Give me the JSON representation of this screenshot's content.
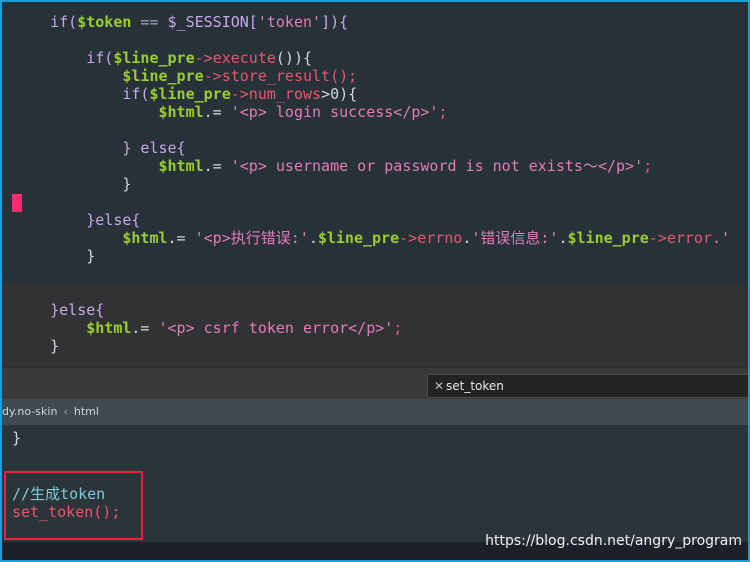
{
  "editor": {
    "lines": [
      [
        {
          "t": "    ",
          "c": "pl"
        },
        {
          "t": "if(",
          "c": "kw"
        },
        {
          "t": "$token",
          "c": "var"
        },
        {
          "t": " == ",
          "c": "op"
        },
        {
          "t": "$_SESSION[",
          "c": "kw"
        },
        {
          "t": "'token'",
          "c": "str"
        },
        {
          "t": "]){",
          "c": "kw"
        }
      ],
      [],
      [
        {
          "t": "        ",
          "c": "pl"
        },
        {
          "t": "if(",
          "c": "kw"
        },
        {
          "t": "$line_pre",
          "c": "var"
        },
        {
          "t": "->",
          "c": "fn"
        },
        {
          "t": "execute",
          "c": "fn"
        },
        {
          "t": "()){",
          "c": "pl"
        }
      ],
      [
        {
          "t": "            ",
          "c": "pl"
        },
        {
          "t": "$line_pre",
          "c": "var"
        },
        {
          "t": "->",
          "c": "fn"
        },
        {
          "t": "store_result",
          "c": "fn"
        },
        {
          "t": "();",
          "c": "fn"
        }
      ],
      [
        {
          "t": "            ",
          "c": "pl"
        },
        {
          "t": "if(",
          "c": "kw"
        },
        {
          "t": "$line_pre",
          "c": "var"
        },
        {
          "t": "->",
          "c": "fn"
        },
        {
          "t": "num_rows",
          "c": "fn"
        },
        {
          "t": ">0){",
          "c": "pl"
        }
      ],
      [
        {
          "t": "                ",
          "c": "pl"
        },
        {
          "t": "$html",
          "c": "var"
        },
        {
          "t": ".= ",
          "c": "pl"
        },
        {
          "t": "'<p> login success</p>'",
          "c": "str"
        },
        {
          "t": ";",
          "c": "fn"
        }
      ],
      [],
      [
        {
          "t": "            ",
          "c": "pl"
        },
        {
          "t": "} else{",
          "c": "kw"
        }
      ],
      [
        {
          "t": "                ",
          "c": "pl"
        },
        {
          "t": "$html",
          "c": "var"
        },
        {
          "t": ".= ",
          "c": "pl"
        },
        {
          "t": "'<p> username or password is not exists～</p>'",
          "c": "str"
        },
        {
          "t": ";",
          "c": "fn"
        }
      ],
      [
        {
          "t": "            ",
          "c": "pl"
        },
        {
          "t": "}",
          "c": "pl"
        }
      ],
      [],
      [
        {
          "t": "        ",
          "c": "pl"
        },
        {
          "t": "}else{",
          "c": "kw"
        }
      ],
      [
        {
          "t": "            ",
          "c": "pl"
        },
        {
          "t": "$html",
          "c": "var"
        },
        {
          "t": ".= ",
          "c": "pl"
        },
        {
          "t": "'<p>执行错误:'",
          "c": "str"
        },
        {
          "t": ".",
          "c": "pl"
        },
        {
          "t": "$line_pre",
          "c": "var"
        },
        {
          "t": "->",
          "c": "fn"
        },
        {
          "t": "errno",
          "c": "fn"
        },
        {
          "t": ".",
          "c": "pl"
        },
        {
          "t": "'错误信息:'",
          "c": "str"
        },
        {
          "t": ".",
          "c": "pl"
        },
        {
          "t": "$line_pre",
          "c": "var"
        },
        {
          "t": "->",
          "c": "fn"
        },
        {
          "t": "error",
          "c": "fn"
        },
        {
          "t": ".'",
          "c": "str"
        }
      ],
      [
        {
          "t": "        ",
          "c": "pl"
        },
        {
          "t": "}",
          "c": "pl"
        }
      ],
      [],
      [],
      [
        {
          "t": "    ",
          "c": "pl"
        },
        {
          "t": "}else{",
          "c": "kw"
        }
      ],
      [
        {
          "t": "        ",
          "c": "pl"
        },
        {
          "t": "$html",
          "c": "var"
        },
        {
          "t": ".= ",
          "c": "pl"
        },
        {
          "t": "'<p> csrf token error</p>'",
          "c": "str"
        },
        {
          "t": ";",
          "c": "fn"
        }
      ],
      [
        {
          "t": "    ",
          "c": "pl"
        },
        {
          "t": "}",
          "c": "pl"
        }
      ]
    ],
    "cursor_marker_color": "#ff2d6f"
  },
  "tabbar": {
    "active_tab_label": "set_token",
    "close_glyph": "✕"
  },
  "breadcrumb": {
    "items": [
      "dy.no-skin",
      "html"
    ],
    "separator": "‹"
  },
  "editor_bottom": {
    "closing_brace": "}",
    "comment": "//生成token",
    "call_name": "set_token",
    "call_punc": "();"
  },
  "watermark": "https://blog.csdn.net/angry_program",
  "colors": {
    "frame_border": "#1a9fd6",
    "highlight_box": "#e8213f"
  }
}
